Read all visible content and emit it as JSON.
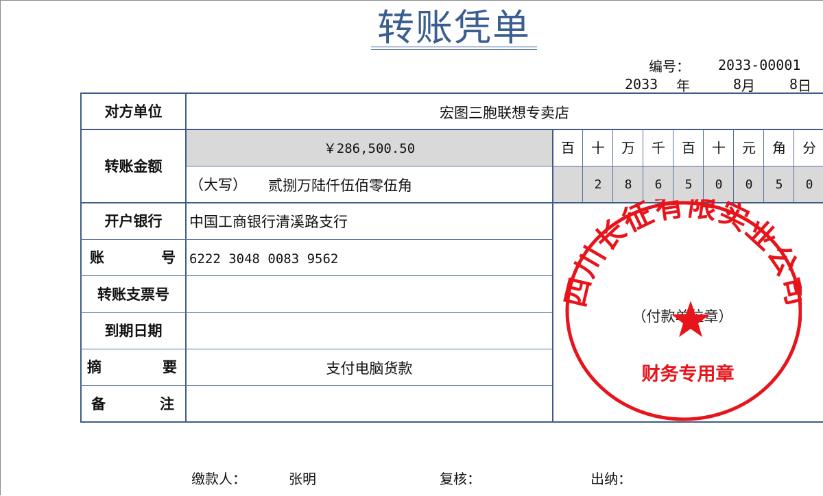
{
  "title": "转账凭单",
  "header": {
    "number_label": "编号：",
    "number_value": "2033-00001",
    "year": "2033",
    "year_unit": "年",
    "month": "8",
    "month_unit": "月",
    "day": "8",
    "day_unit": "日"
  },
  "form": {
    "counterparty_label": "对方单位",
    "counterparty_value": "宏图三胞联想专卖店",
    "amount_label": "转账金额",
    "amount_numeric": "￥286,500.50",
    "amount_words_prefix": "（大写）",
    "amount_words": "贰捌万陆仟伍佰零伍角",
    "digit_headers": [
      "百",
      "十",
      "万",
      "千",
      "百",
      "十",
      "元",
      "角",
      "分"
    ],
    "digit_values": [
      "",
      "2",
      "8",
      "6",
      "5",
      "0",
      "0",
      "5",
      "0"
    ],
    "bank_label": "开户银行",
    "bank_value": "中国工商银行清溪路支行",
    "account_label_a": "账",
    "account_label_b": "号",
    "account_value": "6222 3048 0083 9562",
    "cheque_label": "转账支票号",
    "cheque_value": "",
    "due_label": "到期日期",
    "due_value": "",
    "summary_label_a": "摘",
    "summary_label_b": "要",
    "summary_value": "支付电脑货款",
    "remark_label_a": "备",
    "remark_label_b": "注",
    "remark_value": ""
  },
  "seal": {
    "company": "四川长征有限实业公司",
    "caption": "（付款单位章）",
    "bottom_text": "财务专用章",
    "color": "#e8141b"
  },
  "footer": {
    "payer_label": "缴款人：",
    "payer_value": "张明",
    "reviewer_label": "复核：",
    "cashier_label": "出纳："
  }
}
